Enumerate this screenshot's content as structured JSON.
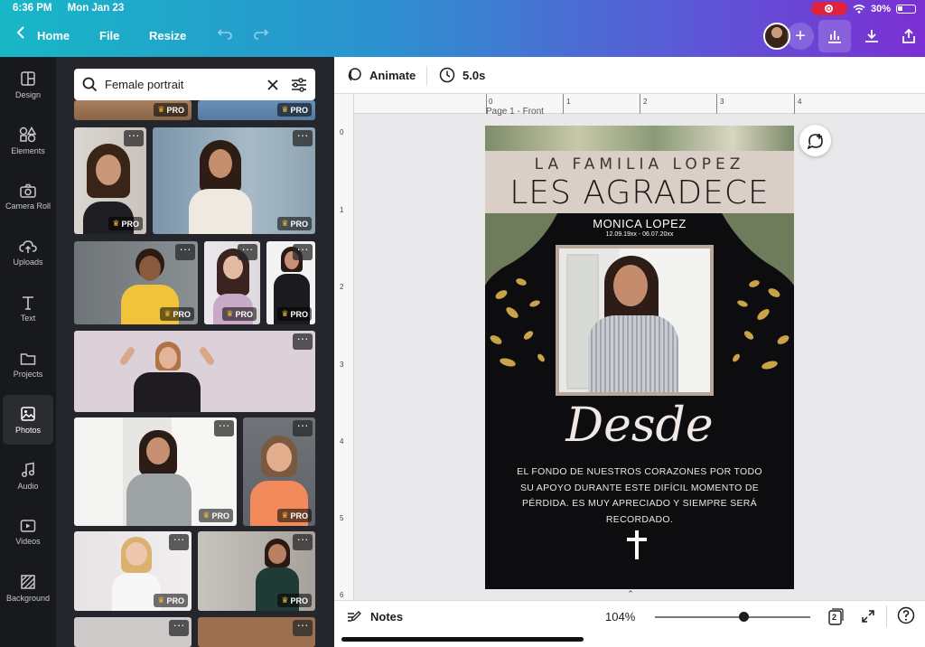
{
  "status_bar": {
    "time": "6:36 PM",
    "date": "Mon Jan 23",
    "battery": "30%"
  },
  "header": {
    "home_label": "Home",
    "file_label": "File",
    "resize_label": "Resize"
  },
  "rail": [
    {
      "label": "Design",
      "icon": "design-icon"
    },
    {
      "label": "Elements",
      "icon": "elements-icon"
    },
    {
      "label": "Camera Roll",
      "icon": "camera-icon"
    },
    {
      "label": "Uploads",
      "icon": "upload-cloud-icon"
    },
    {
      "label": "Text",
      "icon": "text-icon"
    },
    {
      "label": "Projects",
      "icon": "folder-icon"
    },
    {
      "label": "Photos",
      "icon": "photo-icon"
    },
    {
      "label": "Audio",
      "icon": "music-note-icon"
    },
    {
      "label": "Videos",
      "icon": "video-icon"
    },
    {
      "label": "Background",
      "icon": "background-icon"
    }
  ],
  "search": {
    "value": "Female portrait"
  },
  "pro_label": "PRO",
  "toolbar": {
    "animate_label": "Animate",
    "duration": "5.0s"
  },
  "ruler": {
    "h": [
      "0",
      "1",
      "2",
      "3",
      "4"
    ],
    "v": [
      "0",
      "1",
      "2",
      "3",
      "4",
      "5",
      "6"
    ]
  },
  "page_label": "Page 1 - Front",
  "design": {
    "family": "LA FAMILIA LOPEZ",
    "agradece": "LES AGRADECE",
    "name": "MONICA LOPEZ",
    "dates": "12.09.19xx - 06.07.20xx",
    "script": "Desde",
    "body": "EL FONDO DE NUESTROS CORAZONES POR TODO SU APOYO DURANTE ESTE DIFÍCIL MOMENTO DE PÉRDIDA. ES MUY APRECIADO Y SIEMPRE SERÁ RECORDADO."
  },
  "bottom": {
    "notes_label": "Notes",
    "zoom": "104%",
    "zoom_level": 0.57,
    "page_count": "2"
  },
  "colors": {
    "accent": "#7b2fd4",
    "teal": "#17b7c6",
    "gold": "#c9a24a"
  }
}
